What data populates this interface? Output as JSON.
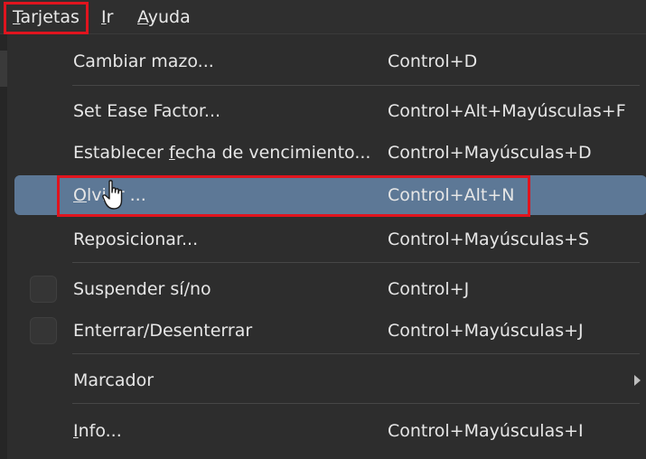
{
  "menubar": {
    "items": [
      {
        "first": "T",
        "rest": "arjetas"
      },
      {
        "first": "I",
        "rest": "r"
      },
      {
        "first": "A",
        "rest": "yuda"
      }
    ]
  },
  "menu": {
    "items": [
      {
        "label": "Cambiar mazo...",
        "shortcut": "Control+D"
      },
      {
        "label": "Set Ease Factor...",
        "shortcut": "Control+Alt+Mayúsculas+F"
      },
      {
        "label_pre": "Establecer ",
        "label_ul": "f",
        "label_post": "echa de vencimiento...",
        "shortcut": "Control+Mayúsculas+D"
      },
      {
        "label_ul": "O",
        "label_post": "lvi",
        "label_tail": "r ...",
        "shortcut": "Control+Alt+N"
      },
      {
        "label": "Reposicionar...",
        "shortcut": "Control+Mayúsculas+S"
      },
      {
        "label": "Suspender sí/no",
        "shortcut": "Control+J"
      },
      {
        "label": "Enterrar/Desenterrar",
        "shortcut": "Control+Mayúsculas+J"
      },
      {
        "label": "Marcador",
        "shortcut": ""
      },
      {
        "label_ul": "I",
        "label_post": "nfo...",
        "shortcut": "Control+Mayúsculas+I"
      }
    ]
  },
  "colors": {
    "highlight_border": "#e0141e",
    "active_row": "#5d7896"
  }
}
